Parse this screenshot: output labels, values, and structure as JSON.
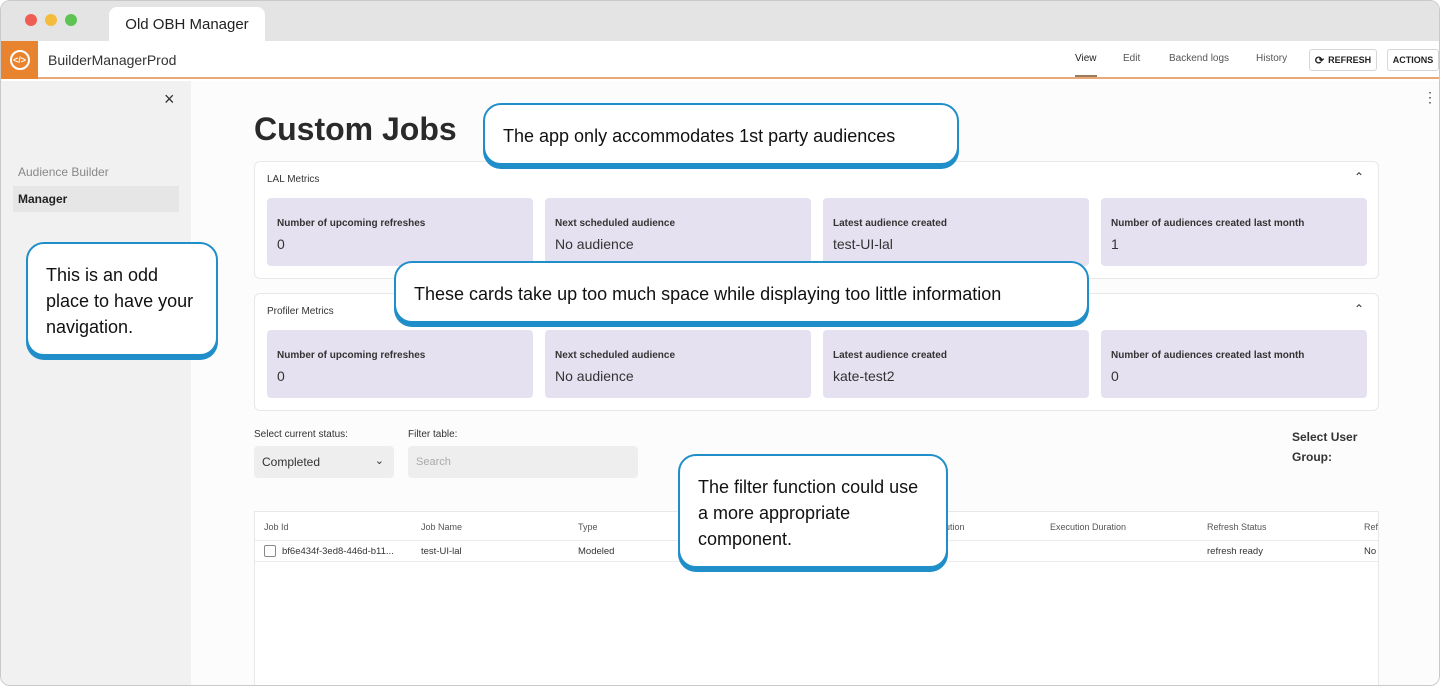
{
  "browser": {
    "tab_title": "Old OBH Manager"
  },
  "appbar": {
    "app_name": "BuilderManagerProd",
    "tabs": [
      "View",
      "Edit",
      "Backend logs",
      "History"
    ],
    "refresh_label": "REFRESH",
    "actions_label": "ACTIONS"
  },
  "sidebar": {
    "close_icon": "×",
    "items": [
      {
        "label": "Audience Builder",
        "active": false
      },
      {
        "label": "Manager",
        "active": true
      }
    ]
  },
  "main": {
    "title": "Custom Jobs",
    "lal_metrics": {
      "title": "LAL Metrics",
      "cards": [
        {
          "label": "Number of upcoming refreshes",
          "value": "0"
        },
        {
          "label": "Next scheduled audience",
          "value": "No audience"
        },
        {
          "label": "Latest audience created",
          "value": "test-UI-lal"
        },
        {
          "label": "Number of audiences created last month",
          "value": "1"
        }
      ]
    },
    "profiler_metrics": {
      "title": "Profiler Metrics",
      "cards": [
        {
          "label": "Number of upcoming refreshes",
          "value": "0"
        },
        {
          "label": "Next scheduled audience",
          "value": "No audience"
        },
        {
          "label": "Latest audience created",
          "value": "kate-test2"
        },
        {
          "label": "Number of audiences created last month",
          "value": "0"
        }
      ]
    },
    "filters": {
      "status_label": "Select current status:",
      "status_value": "Completed",
      "filter_label": "Filter table:",
      "search_placeholder": "Search",
      "user_group_label": "Select User Group:"
    },
    "table": {
      "columns": [
        "Job Id",
        "Job Name",
        "Type",
        "ution",
        "Execution Duration",
        "Refresh Status",
        "Ref"
      ],
      "rows": [
        [
          "bf6e434f-3ed8-446d-b11...",
          "test-UI-lal",
          "Modeled",
          "",
          "",
          "refresh ready",
          "No"
        ]
      ]
    }
  },
  "callouts": {
    "party": "The app only accommodates 1st party audiences",
    "cards": "These cards take up too much space while displaying too little information",
    "nav": "This is an odd place to have your navigation.",
    "filter": "The filter function could use a more appropriate component."
  },
  "colors": {
    "accent": "#1f8ec9",
    "card_bg": "#e6e1f0",
    "logo": "#e8842f"
  }
}
